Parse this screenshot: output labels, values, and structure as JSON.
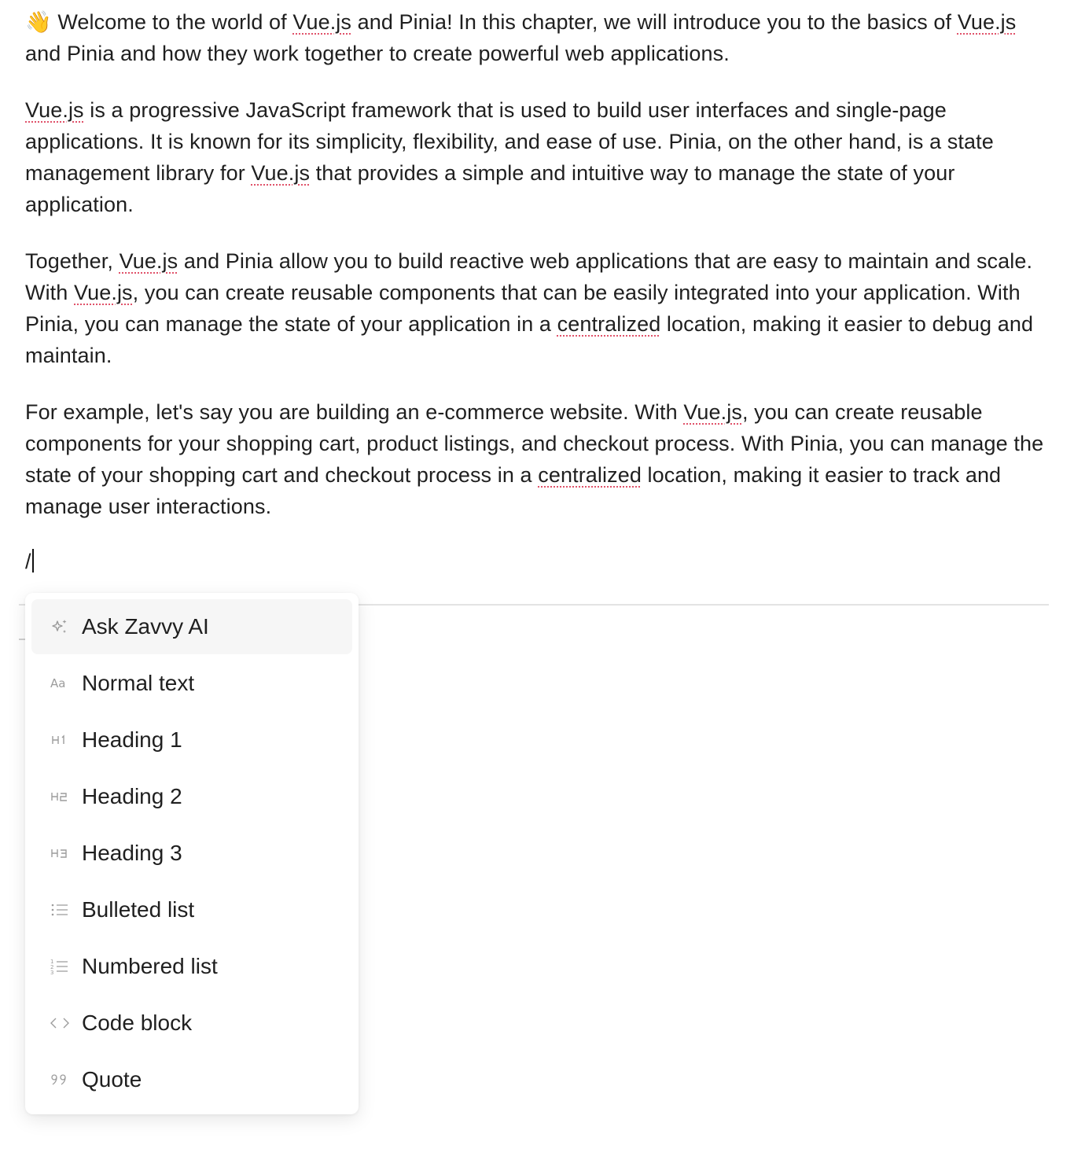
{
  "editor": {
    "paragraphs": [
      {
        "segments": [
          {
            "text": "👋 Welcome to the world of "
          },
          {
            "text": "Vue.js",
            "spell": true
          },
          {
            "text": " and Pinia! In this chapter, we will introduce you to the basics of "
          },
          {
            "text": "Vue.js",
            "spell": true
          },
          {
            "text": " and Pinia and how they work together to create powerful web applications."
          }
        ]
      },
      {
        "segments": [
          {
            "text": "Vue.js",
            "spell": true
          },
          {
            "text": " is a progressive JavaScript framework that is used to build user interfaces and single-page applications. It is known for its simplicity, flexibility, and ease of use. Pinia, on the other hand, is a state management library for "
          },
          {
            "text": "Vue.js",
            "spell": true
          },
          {
            "text": " that provides a simple and intuitive way to manage the state of your application."
          }
        ]
      },
      {
        "segments": [
          {
            "text": "Together, "
          },
          {
            "text": "Vue.js",
            "spell": true
          },
          {
            "text": " and Pinia allow you to build reactive web applications that are easy to maintain and scale. With "
          },
          {
            "text": "Vue.js",
            "spell": true
          },
          {
            "text": ", you can create reusable components that can be easily integrated into your application. With Pinia, you can manage the state of your application in a "
          },
          {
            "text": "centralized",
            "spell": true
          },
          {
            "text": " location, making it easier to debug and maintain."
          }
        ]
      },
      {
        "segments": [
          {
            "text": "For example, let's say you are building an e-commerce website. With "
          },
          {
            "text": "Vue.js",
            "spell": true
          },
          {
            "text": ", you can create reusable components for your shopping cart, product listings, and checkout process. With Pinia, you can manage the state of your shopping cart and checkout process in a "
          },
          {
            "text": "centralized",
            "spell": true
          },
          {
            "text": " location, making it easier to track and manage user interactions."
          }
        ]
      }
    ],
    "slash_input": "/"
  },
  "slash_menu": {
    "items": [
      {
        "label": "Ask Zavvy AI",
        "icon": "sparkle-icon",
        "active": true
      },
      {
        "label": "Normal text",
        "icon": "text-icon"
      },
      {
        "label": "Heading 1",
        "icon": "heading-1-icon"
      },
      {
        "label": "Heading 2",
        "icon": "heading-2-icon"
      },
      {
        "label": "Heading 3",
        "icon": "heading-3-icon"
      },
      {
        "label": "Bulleted list",
        "icon": "bulleted-list-icon"
      },
      {
        "label": "Numbered list",
        "icon": "numbered-list-icon"
      },
      {
        "label": "Code block",
        "icon": "code-icon"
      },
      {
        "label": "Quote",
        "icon": "quote-icon"
      }
    ]
  },
  "colors": {
    "spellcheck_underline": "#e0526a",
    "text": "#1f1f1f",
    "icon": "#9a9a9a",
    "active_item_bg": "#f6f6f6"
  }
}
